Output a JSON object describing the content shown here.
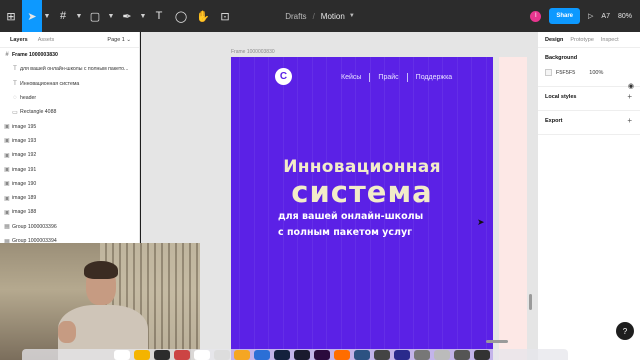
{
  "toolbar": {
    "tools": [
      {
        "name": "main-menu-icon",
        "glyph": "⊞"
      },
      {
        "name": "move-tool-icon",
        "glyph": "➤"
      },
      {
        "name": "frame-tool-icon",
        "glyph": "#"
      },
      {
        "name": "shape-tool-icon",
        "glyph": "▢"
      },
      {
        "name": "pen-tool-icon",
        "glyph": "✒"
      },
      {
        "name": "text-tool-icon",
        "glyph": "T"
      },
      {
        "name": "comment-tool-icon",
        "glyph": "◯"
      },
      {
        "name": "hand-tool-icon",
        "glyph": "✋"
      },
      {
        "name": "resources-icon",
        "glyph": "⊡"
      }
    ],
    "project": "Drafts",
    "separator": "/",
    "file_name": "Motion",
    "user_initial": "I",
    "share_label": "Share",
    "play_glyph": "▷",
    "aa_label": "A7",
    "zoom": "80%"
  },
  "left_panel": {
    "tab_layers": "Layers",
    "tab_assets": "Assets",
    "page_label": "Page 1",
    "layers": [
      {
        "name": "Frame 1000003830",
        "icon": "#",
        "depth": 0,
        "bold": true
      },
      {
        "name": "для вашей онлайн-школы с полным пакето...",
        "icon": "T",
        "depth": 1,
        "bold": false
      },
      {
        "name": "Инновационная система",
        "icon": "T",
        "depth": 1,
        "bold": false
      },
      {
        "name": "header",
        "icon": "◌",
        "depth": 1,
        "bold": false
      },
      {
        "name": "Rectangle 4088",
        "icon": "▭",
        "depth": 1,
        "bold": false
      },
      {
        "name": "image 195",
        "icon": "▣",
        "depth": 0,
        "bold": false
      },
      {
        "name": "image 193",
        "icon": "▣",
        "depth": 0,
        "bold": false
      },
      {
        "name": "image 192",
        "icon": "▣",
        "depth": 0,
        "bold": false
      },
      {
        "name": "image 191",
        "icon": "▣",
        "depth": 0,
        "bold": false
      },
      {
        "name": "image 190",
        "icon": "▣",
        "depth": 0,
        "bold": false
      },
      {
        "name": "image 189",
        "icon": "▣",
        "depth": 0,
        "bold": false
      },
      {
        "name": "image 188",
        "icon": "▣",
        "depth": 0,
        "bold": false
      },
      {
        "name": "Group 1000003396",
        "icon": "▦",
        "depth": 0,
        "bold": false
      },
      {
        "name": "Group 1000003394",
        "icon": "▦",
        "depth": 0,
        "bold": false
      }
    ]
  },
  "canvas": {
    "frame_label": "Frame 1000003830",
    "logo_glyph": "C",
    "nav": [
      "Кейсы",
      "Прайс",
      "Поддержка"
    ],
    "headline_1": "Инновационная",
    "headline_2": "система",
    "subline_1": "для вашей онлайн-школы",
    "subline_2": "с полным пакетом услуг",
    "frame_color": "#5b21e6",
    "headline_color": "#f2ecc9"
  },
  "right_panel": {
    "tab_design": "Design",
    "tab_prototype": "Prototype",
    "tab_inspect": "Inspect",
    "background_title": "Background",
    "background_hex": "F5F5F5",
    "background_opacity": "100%",
    "local_styles": "Local styles",
    "export": "Export",
    "help": "?"
  },
  "dock": {
    "apps": [
      "#ffffff",
      "#f4b400",
      "#2c2c2c",
      "#c44",
      "#fff",
      "#ddd",
      "#f5a623",
      "#2b6fd6",
      "#14213d",
      "#1a1a2e",
      "#2b0a3d",
      "#ff6d00",
      "#2c5282",
      "#444",
      "#2a2a8c",
      "#777",
      "#bbb",
      "#555",
      "#333"
    ]
  }
}
